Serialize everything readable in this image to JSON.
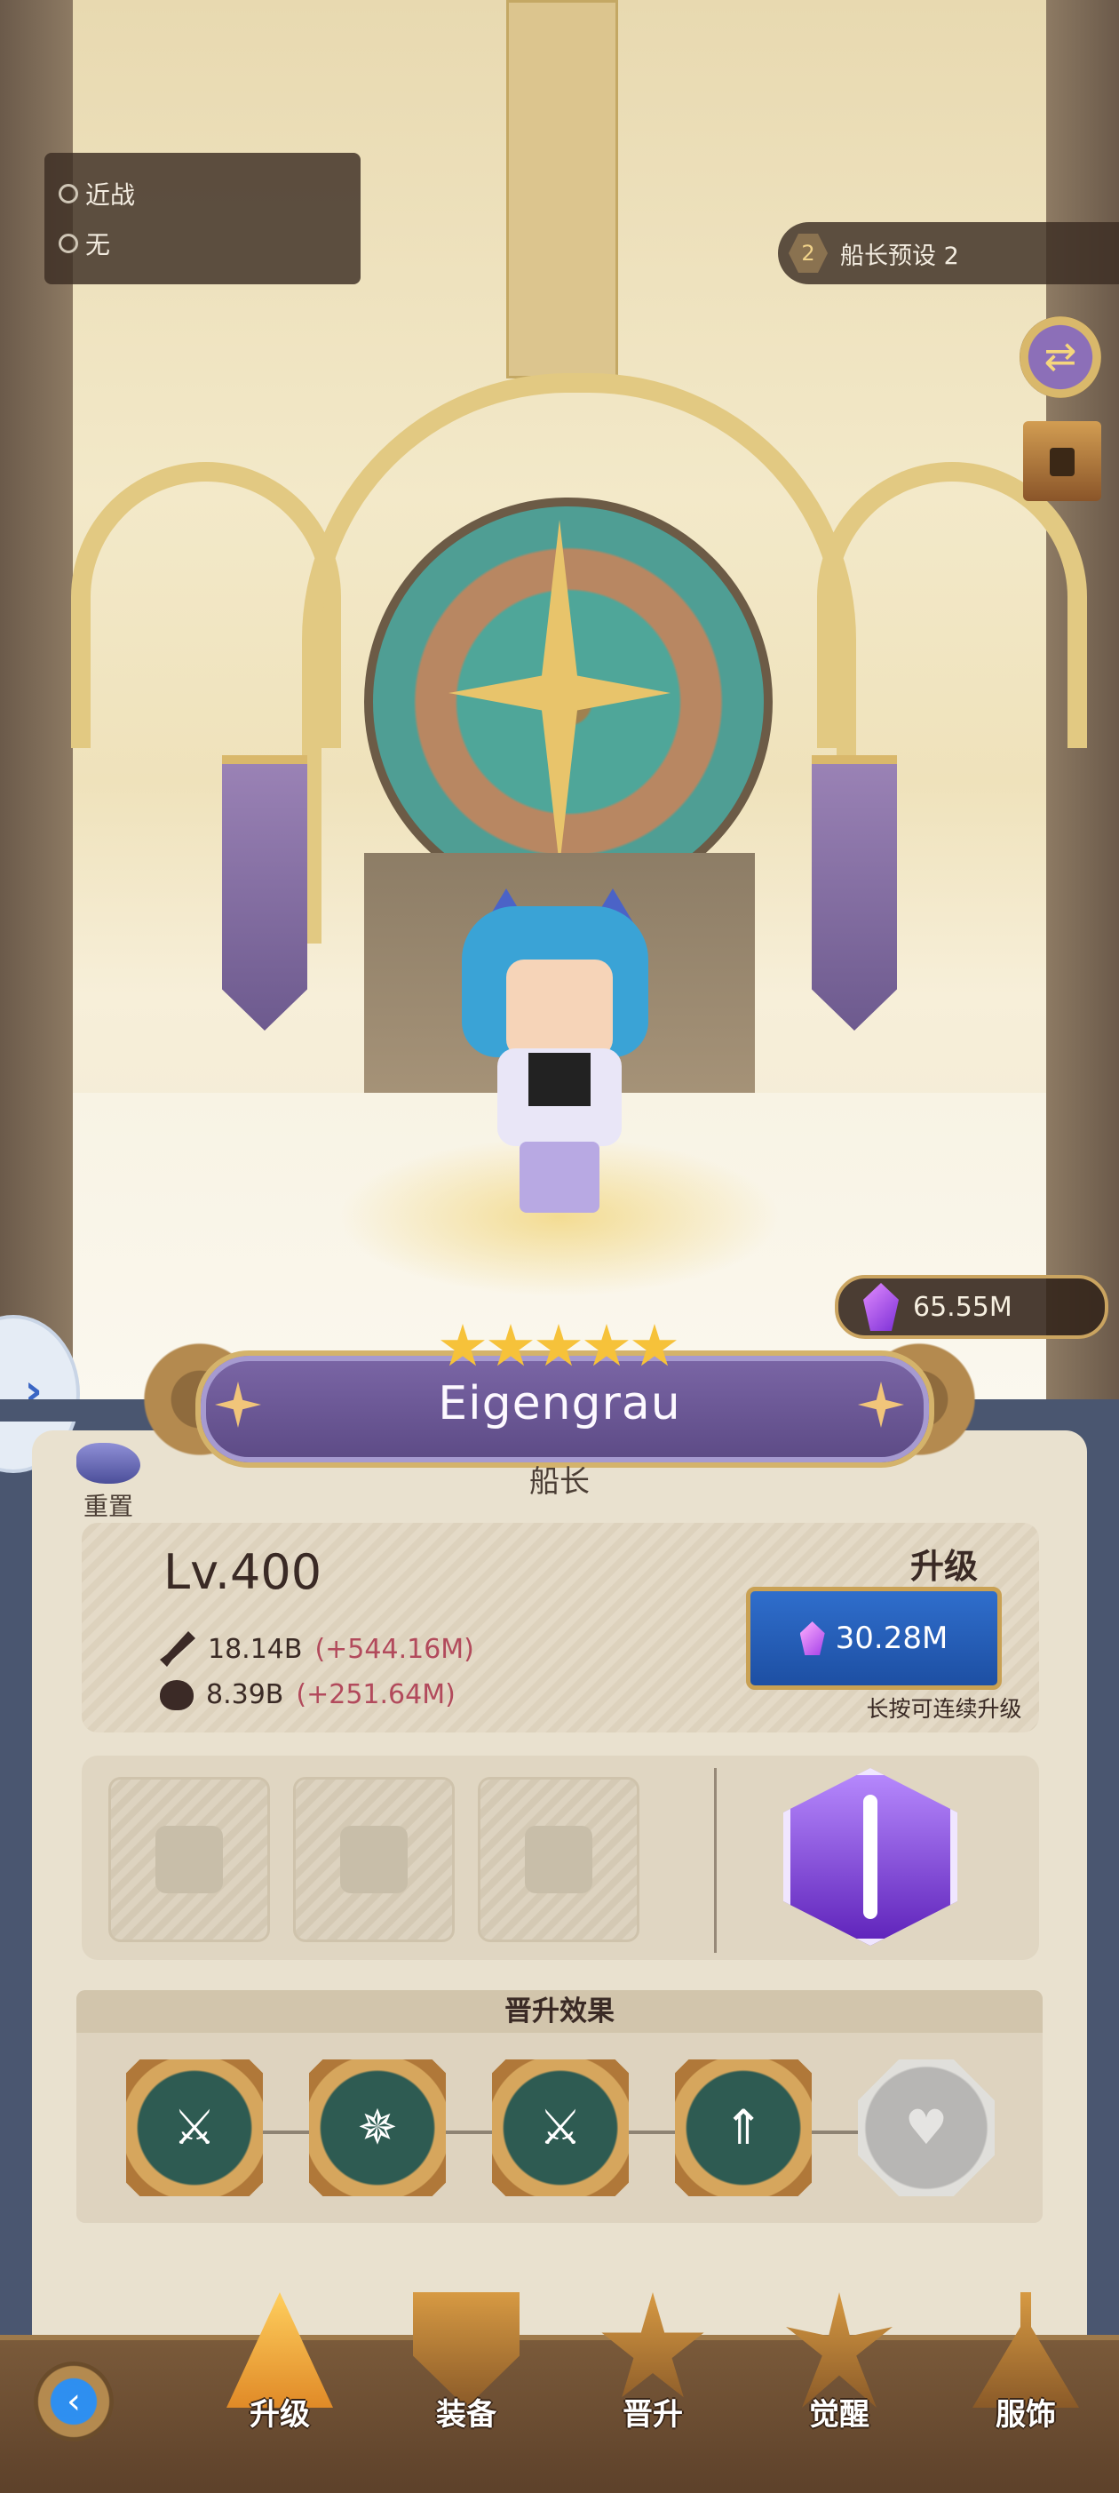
{
  "info_box": {
    "type_label": "近战",
    "element_label": "无"
  },
  "preset": {
    "number": "2",
    "label": "船长预设 2"
  },
  "currency": {
    "amount": "65.55M"
  },
  "hero": {
    "name": "Eigengrau",
    "role": "船长",
    "stars": 5,
    "level": "Lv.400",
    "attack": "18.14B",
    "attack_bonus": "(+544.16M)",
    "hp": "8.39B",
    "hp_bonus": "(+251.64M)"
  },
  "reset": {
    "label": "重置",
    "info_icon": "i"
  },
  "upgrade": {
    "title": "升级",
    "cost": "30.28M",
    "hint": "长按可连续升级"
  },
  "equipment": {
    "slots": [
      {
        "icon": "shield-swords-icon"
      },
      {
        "icon": "armor-icon"
      },
      {
        "icon": "necklace-icon"
      }
    ],
    "featured": {
      "icon": "purple-sword-icon"
    }
  },
  "promotion": {
    "title": "晋升效果",
    "nodes": [
      {
        "icon": "attack-boost-icon",
        "locked": false
      },
      {
        "icon": "crit-boost-icon",
        "locked": false
      },
      {
        "icon": "sword-boost-icon",
        "locked": false
      },
      {
        "icon": "speed-boost-icon",
        "locked": false
      },
      {
        "icon": "heart-locked-icon",
        "locked": true
      }
    ]
  },
  "nav": {
    "items": [
      {
        "label": "升级",
        "icon": "upgrade-icon",
        "active": true
      },
      {
        "label": "装备",
        "icon": "equipment-icon",
        "active": false
      },
      {
        "label": "晋升",
        "icon": "promote-icon",
        "active": false
      },
      {
        "label": "觉醒",
        "icon": "awaken-icon",
        "active": false
      },
      {
        "label": "服饰",
        "icon": "costume-icon",
        "active": false
      }
    ]
  }
}
